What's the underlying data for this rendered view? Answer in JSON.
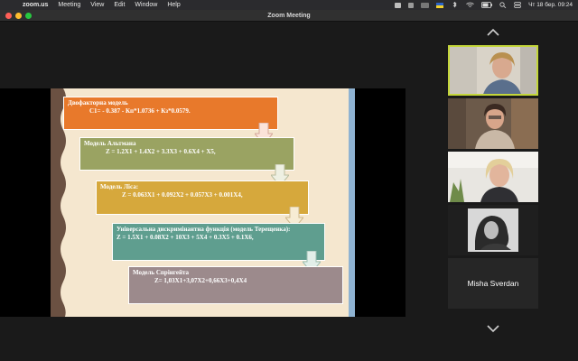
{
  "menubar": {
    "app": "zoom.us",
    "items": [
      "Meeting",
      "View",
      "Edit",
      "Window",
      "Help"
    ],
    "datetime": "Чт 18 бер.  09:24"
  },
  "window": {
    "title": "Zoom Meeting"
  },
  "slide": {
    "models": [
      {
        "heading": "Двофакторна модель",
        "formula": "C1= - 0.387 - Кп*1.0736 + Кз*0.0579.",
        "color": "#e8792b"
      },
      {
        "heading": "Модель Альтмана",
        "formula": "Z = 1.2X1 + 1.4X2 + 3.3X3 + 0.6X4 + X5,",
        "color": "#9aa362"
      },
      {
        "heading": "Модель Ліса:",
        "formula": "Z = 0.063X1 + 0.092X2 + 0.057X3 + 0.001X4,",
        "color": "#d6a83c"
      },
      {
        "heading": "Універсальна дискримінантна функція (модель Терещенка):",
        "formula": "Z = 1.5X1 + 0.08X2 + 10X3 + 5X4 + 0.3X5 + 0.1X6,",
        "color": "#5f9e8f"
      },
      {
        "heading": "Модель Спрінгейта",
        "formula": "Z= 1,03X1+3,07X2+0,66X3+0,4X4",
        "color": "#9c8a8c"
      }
    ]
  },
  "participants": {
    "named_tile": "Misha Sverdan"
  },
  "icons": {
    "scroll_up": "chevron-up-icon",
    "scroll_down": "chevron-down-icon"
  }
}
